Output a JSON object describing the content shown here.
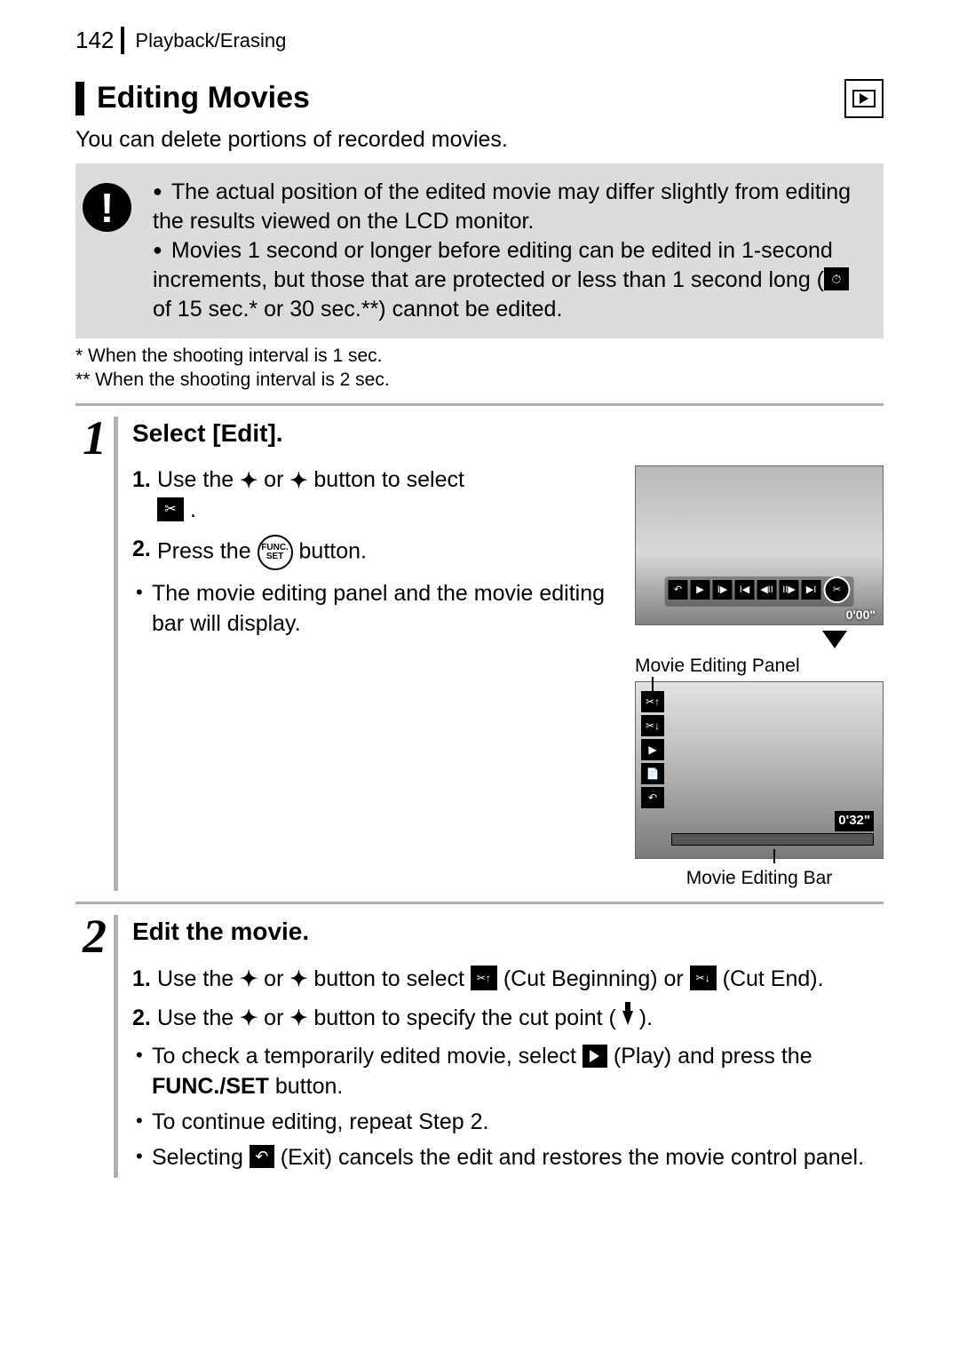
{
  "header": {
    "page_number": "142",
    "crumb": "Playback/Erasing"
  },
  "section": {
    "title": "Editing Movies",
    "intro": "You can delete portions of recorded movies."
  },
  "warning": {
    "items": [
      "The actual position of the edited movie may differ slightly from editing the results viewed on the LCD monitor.",
      "Movies 1 second or longer before editing can be edited in 1-second increments, but those that are protected or less than 1 second long ( of 15 sec.* or 30 sec.**) cannot be edited."
    ]
  },
  "footnotes": {
    "a": "* When the shooting interval is 1 sec.",
    "b": "** When the shooting interval is 2 sec."
  },
  "steps": [
    {
      "num": "1",
      "title": "Select [Edit].",
      "items": [
        {
          "n": "1.",
          "pre": "Use the ",
          "mid": " or ",
          "post": " button to select "
        },
        {
          "n": "2.",
          "pre": "Press the ",
          "post": " button."
        }
      ],
      "note": "The movie editing panel and the movie editing bar will display.",
      "illus": {
        "time_top": "0'00\"",
        "panel_label": "Movie Editing Panel",
        "panel_time": "0'32\"",
        "bar_label": "Movie Editing Bar"
      }
    },
    {
      "num": "2",
      "title": "Edit the movie.",
      "items": [
        {
          "n": "1.",
          "pre": "Use the ",
          "mid": " or ",
          "post1": " button to select ",
          "opt1": " (Cut Beginning) or ",
          "opt2": " (Cut End)."
        },
        {
          "n": "2.",
          "pre": "Use the ",
          "mid": " or ",
          "post": " button to specify the cut point ( ",
          "end": " )."
        }
      ],
      "notes": [
        {
          "pre": "To check a temporarily edited movie, select ",
          "mid": " (Play) and press the ",
          "btn": "FUNC./SET",
          "post": " button."
        },
        {
          "text": "To continue editing, repeat Step 2."
        },
        {
          "pre": "Selecting ",
          "mid": " (Exit) cancels the edit and restores the movie control panel."
        }
      ]
    }
  ]
}
